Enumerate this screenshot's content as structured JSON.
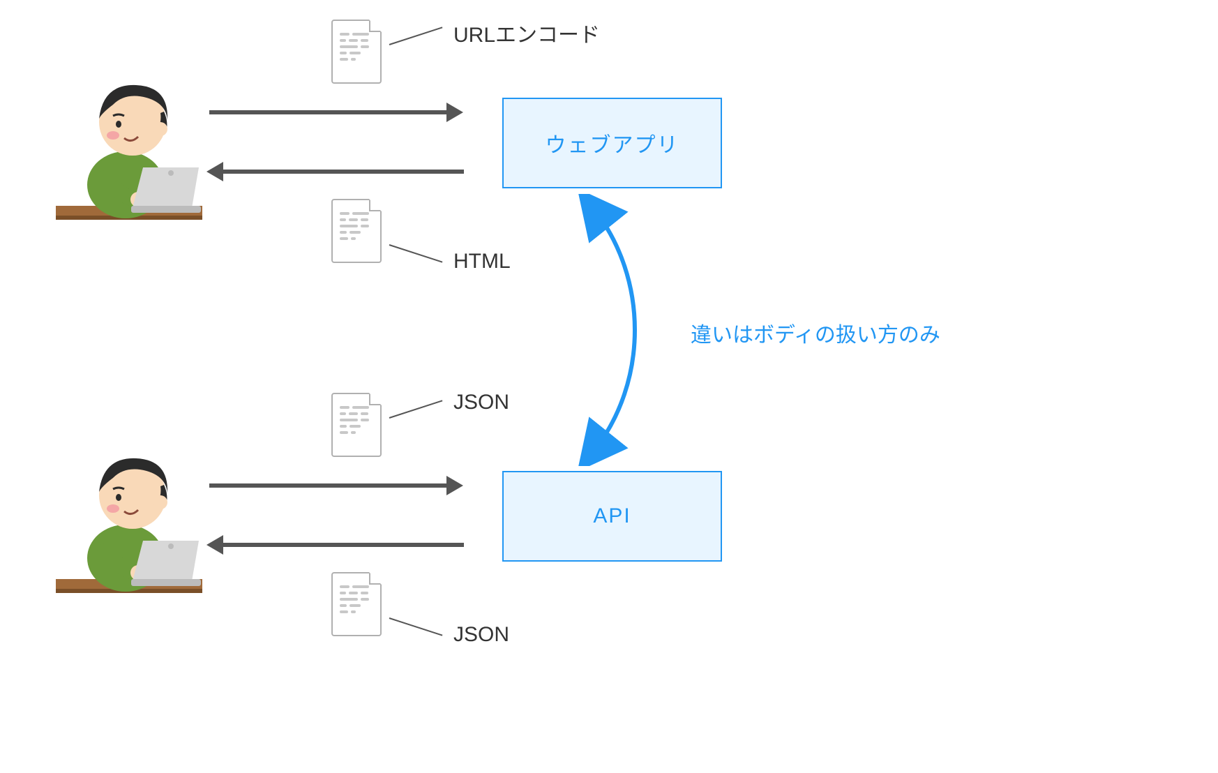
{
  "labels": {
    "url_encode": "URLエンコード",
    "html": "HTML",
    "json_top": "JSON",
    "json_bottom": "JSON",
    "difference_note": "違いはボディの扱い方のみ"
  },
  "boxes": {
    "web_app": "ウェブアプリ",
    "api": "API"
  },
  "colors": {
    "accent": "#2196f3",
    "box_fill": "#e8f5ff",
    "arrow": "#555555",
    "text_dark": "#333333",
    "doc_border": "#b0b0b0"
  }
}
